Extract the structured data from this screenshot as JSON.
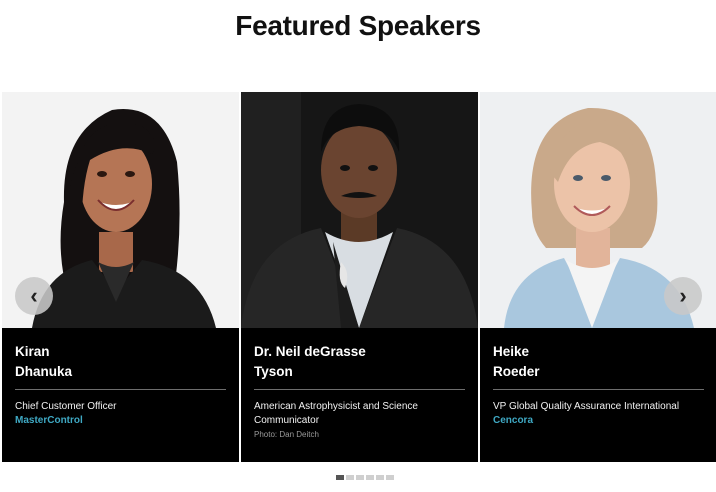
{
  "header": {
    "title": "Featured Speakers"
  },
  "carousel": {
    "prev_icon": "chevron-left-icon",
    "next_icon": "chevron-right-icon",
    "prev_glyph": "‹",
    "next_glyph": "›",
    "page_count": 6,
    "active_page": 0,
    "speakers": [
      {
        "name_line1": "Kiran",
        "name_line2": "Dhanuka",
        "role": "Chief Customer Officer",
        "company": "MasterControl",
        "photo_credit": ""
      },
      {
        "name_line1": "Dr. Neil deGrasse",
        "name_line2": "Tyson",
        "role": "American Astrophysicist and Science Communicator",
        "company": "",
        "photo_credit": "Photo: Dan Deitch"
      },
      {
        "name_line1": "Heike",
        "name_line2": "Roeder",
        "role": "VP Global Quality Assurance International",
        "company": "Cencora",
        "photo_credit": ""
      }
    ]
  },
  "colors": {
    "company_accent": "#3fa9c4",
    "card_bg": "#000000"
  }
}
